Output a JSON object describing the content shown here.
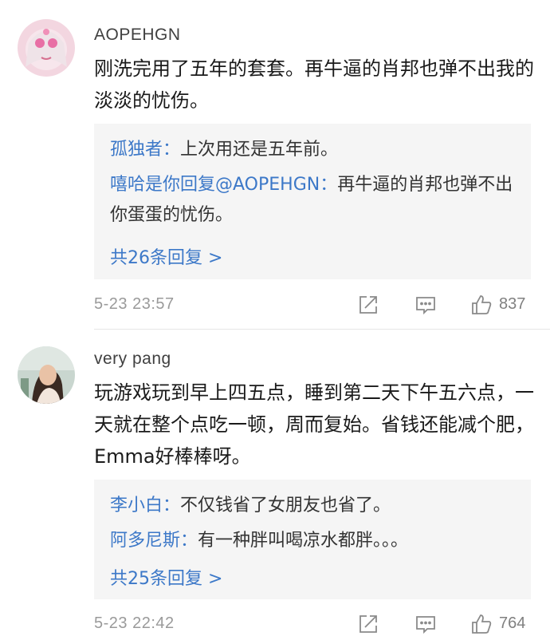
{
  "comments": [
    {
      "username": "AOPEHGN",
      "text": "刚洗完用了五年的套套。再牛逼的肖邦也弹不出我的淡淡的忧伤。",
      "replies": [
        {
          "name": "孤独者：",
          "text": "上次用还是五年前。"
        },
        {
          "name": "嘻哈是你回复@AOPEHGN：",
          "text": "再牛逼的肖邦也弹不出你蛋蛋的忧伤。"
        }
      ],
      "more_replies": "共26条回复 >",
      "timestamp": "5-23  23:57",
      "likes": "837"
    },
    {
      "username": "very pang",
      "text": "玩游戏玩到早上四五点，睡到第二天下午五六点，一天就在整个点吃一顿，周而复始。省钱还能减个肥，Emma好棒棒呀。",
      "replies": [
        {
          "name": "李小白：",
          "text": "不仅钱省了女朋友也省了。"
        },
        {
          "name": "阿多尼斯：",
          "text": "有一种胖叫喝凉水都胖。。。"
        }
      ],
      "more_replies": "共25条回复 >",
      "timestamp": "5-23  22:42",
      "likes": "764"
    }
  ],
  "colors": {
    "link_blue": "#3c78c8",
    "reply_bg": "#f5f5f5",
    "meta_gray": "#9a9a9a"
  },
  "icons": [
    "share-icon",
    "comment-icon",
    "like-icon"
  ]
}
